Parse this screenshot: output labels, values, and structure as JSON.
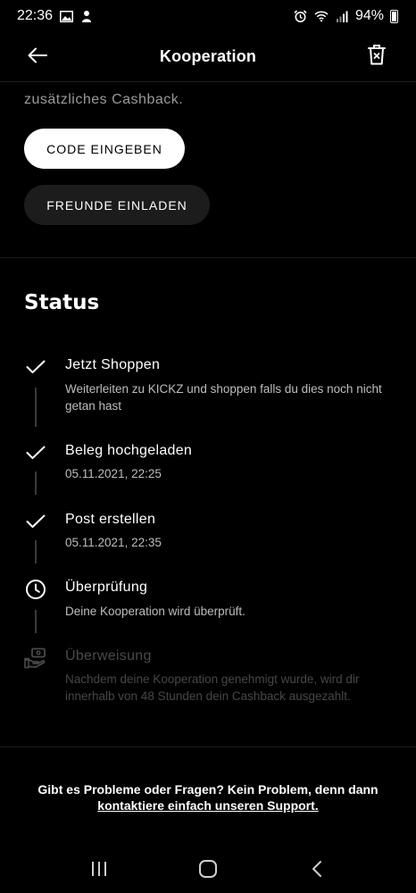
{
  "statusbar": {
    "time": "22:36",
    "battery": "94%"
  },
  "header": {
    "title": "Kooperation"
  },
  "intro": {
    "cashback_text": "zusätzliches Cashback."
  },
  "buttons": {
    "code": "CODE EINGEBEN",
    "invite": "FREUNDE EINLADEN"
  },
  "status": {
    "heading": "Status",
    "steps": [
      {
        "title": "Jetzt Shoppen",
        "desc": "Weiterleiten zu KICKZ und shoppen falls du dies noch nicht getan hast",
        "state": "done",
        "icon": "check-icon"
      },
      {
        "title": "Beleg hochgeladen",
        "desc": "05.11.2021, 22:25",
        "state": "done",
        "icon": "check-icon"
      },
      {
        "title": "Post erstellen",
        "desc": "05.11.2021, 22:35",
        "state": "done",
        "icon": "check-icon"
      },
      {
        "title": "Überprüfung",
        "desc": "Deine Kooperation wird überprüft.",
        "state": "active",
        "icon": "clock-icon"
      },
      {
        "title": "Überweisung",
        "desc": "Nachdem deine Kooperation genehmigt wurde, wird dir innerhalb von 48 Stunden dein Cashback ausgezahlt.",
        "state": "pending",
        "icon": "money-hand-icon"
      }
    ]
  },
  "support": {
    "text": "Gibt es Probleme oder Fragen? Kein Problem, denn dann",
    "link": "kontaktiere einfach unseren Support."
  }
}
